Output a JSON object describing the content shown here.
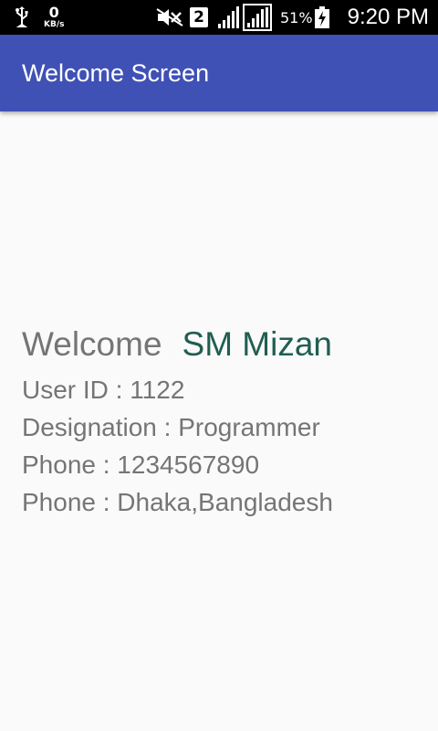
{
  "status_bar": {
    "net_speed_value": "0",
    "net_speed_unit": "KB/s",
    "sim_slot": "2",
    "battery_percent": "51%",
    "time": "9:20 PM",
    "icons": [
      "usb-icon",
      "mute-icon",
      "sim-icon",
      "signal-icon",
      "battery-charging-icon"
    ]
  },
  "app_bar": {
    "title": "Welcome Screen",
    "color": "#3f51b5"
  },
  "profile": {
    "welcome_label": "Welcome",
    "name": "SM Mizan",
    "name_color": "#215e52",
    "user_id": "User ID : 1122",
    "designation": "Designation : Programmer",
    "phone": "Phone : 1234567890",
    "address": "Phone : Dhaka,Bangladesh"
  }
}
